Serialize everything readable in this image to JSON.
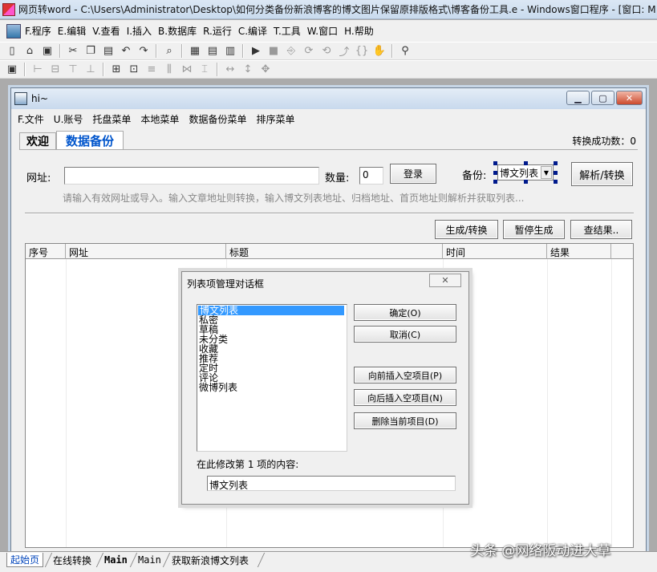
{
  "ide": {
    "title": "网页转word - C:\\Users\\Administrator\\Desktop\\如何分类备份新浪博客的博文图片保留原排版格式\\博客备份工具.e - Windows窗口程序 - [窗口: M",
    "menu": [
      "F.程序",
      "E.编辑",
      "V.查看",
      "I.插入",
      "B.数据库",
      "R.运行",
      "C.编译",
      "T.工具",
      "W.窗口",
      "H.帮助"
    ]
  },
  "window": {
    "title": "hi~",
    "min_icon": "minimize-icon",
    "max_icon": "maximize-icon",
    "close_icon": "close-icon",
    "menu": [
      "F.文件",
      "U.账号",
      "托盘菜单",
      "本地菜单",
      "数据备份菜单",
      "排序菜单"
    ]
  },
  "tabs": {
    "welcome": "欢迎",
    "backup": "数据备份",
    "success_count": "转换成功数：0"
  },
  "form": {
    "url_label": "网址:",
    "url_value": "",
    "count_label": "数量:",
    "count_value": "0",
    "login_button": "登录",
    "backup_label": "备份:",
    "backup_select": "博文列表",
    "parse_button": "解析/转换",
    "hint": "请输入有效网址或导入。输入文章地址则转换，输入博文列表地址、归档地址、首页地址则解析并获取列表..."
  },
  "actions": {
    "generate": "生成/转换",
    "pause": "暂停生成",
    "results": "查结果.."
  },
  "grid": {
    "columns": [
      "序号",
      "网址",
      "标题",
      "时间",
      "结果"
    ]
  },
  "dialog": {
    "title": "列表项管理对话框",
    "items": [
      "博文列表",
      "私密",
      "草稿",
      "未分类",
      "收藏",
      "推荐",
      "定时",
      "评论",
      "微博列表"
    ],
    "selected_index": 0,
    "ok_button": "确定(O)",
    "cancel_button": "取消(C)",
    "insert_before_button": "向前插入空项目(P)",
    "insert_after_button": "向后插入空项目(N)",
    "delete_button": "删除当前项目(D)",
    "edit_label": "在此修改第 1 项的内容:",
    "edit_value": "博文列表"
  },
  "bottom_tabs": [
    "起始页",
    "在线转换",
    "Main",
    "Main",
    "获取新浪博文列表"
  ],
  "watermark": "头条 @网络阪动进大草"
}
